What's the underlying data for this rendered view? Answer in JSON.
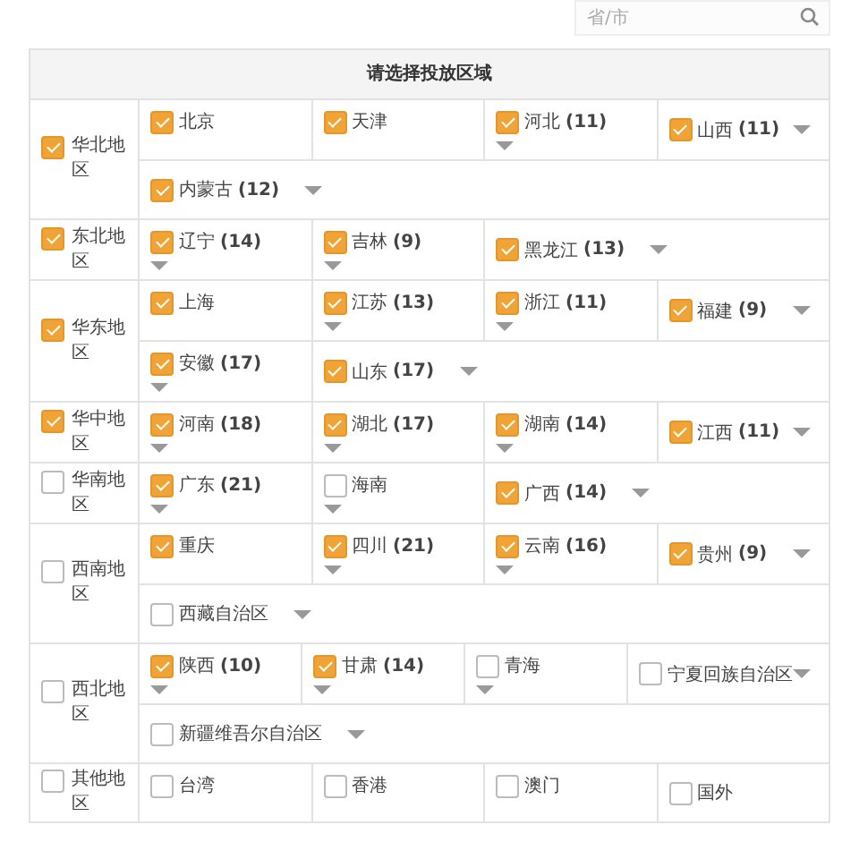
{
  "search": {
    "placeholder": "省/市"
  },
  "table": {
    "title": "请选择投放区域"
  },
  "regions": [
    {
      "name": "华北地区",
      "checked": true,
      "rows": [
        {
          "items": [
            {
              "name": "北京",
              "checked": true,
              "has_dropdown": false
            },
            {
              "name": "天津",
              "checked": true,
              "has_dropdown": false
            },
            {
              "name": "河北",
              "count": "(11)",
              "checked": true,
              "has_dropdown": true
            },
            {
              "name": "山西",
              "count": "(11)",
              "checked": true,
              "has_dropdown": true
            }
          ]
        },
        {
          "items": [
            {
              "name": "内蒙古",
              "count": "(12)",
              "checked": true,
              "has_dropdown": true
            }
          ]
        }
      ]
    },
    {
      "name": "东北地区",
      "checked": true,
      "rows": [
        {
          "items": [
            {
              "name": "辽宁",
              "count": "(14)",
              "checked": true,
              "has_dropdown": true
            },
            {
              "name": "吉林",
              "count": "(9)",
              "checked": true,
              "has_dropdown": true
            },
            {
              "name": "黑龙江",
              "count": "(13)",
              "checked": true,
              "has_dropdown": true
            }
          ]
        }
      ]
    },
    {
      "name": "华东地区",
      "checked": true,
      "rows": [
        {
          "items": [
            {
              "name": "上海",
              "checked": true,
              "has_dropdown": false
            },
            {
              "name": "江苏",
              "count": "(13)",
              "checked": true,
              "has_dropdown": true
            },
            {
              "name": "浙江",
              "count": "(11)",
              "checked": true,
              "has_dropdown": true
            },
            {
              "name": "福建",
              "count": "(9)",
              "checked": true,
              "has_dropdown": true
            }
          ]
        },
        {
          "items": [
            {
              "name": "安徽",
              "count": "(17)",
              "checked": true,
              "has_dropdown": true
            },
            {
              "name": "山东",
              "count": "(17)",
              "checked": true,
              "has_dropdown": true
            }
          ]
        }
      ]
    },
    {
      "name": "华中地区",
      "checked": true,
      "rows": [
        {
          "items": [
            {
              "name": "河南",
              "count": "(18)",
              "checked": true,
              "has_dropdown": true
            },
            {
              "name": "湖北",
              "count": "(17)",
              "checked": true,
              "has_dropdown": true
            },
            {
              "name": "湖南",
              "count": "(14)",
              "checked": true,
              "has_dropdown": true
            },
            {
              "name": "江西",
              "count": "(11)",
              "checked": true,
              "has_dropdown": true
            }
          ]
        }
      ]
    },
    {
      "name": "华南地区",
      "checked": false,
      "rows": [
        {
          "items": [
            {
              "name": "广东",
              "count": "(21)",
              "checked": true,
              "has_dropdown": true
            },
            {
              "name": "海南",
              "checked": false,
              "has_dropdown": true
            },
            {
              "name": "广西",
              "count": "(14)",
              "checked": true,
              "has_dropdown": true
            }
          ]
        }
      ]
    },
    {
      "name": "西南地区",
      "checked": false,
      "rows": [
        {
          "items": [
            {
              "name": "重庆",
              "checked": true,
              "has_dropdown": false
            },
            {
              "name": "四川",
              "count": "(21)",
              "checked": true,
              "has_dropdown": true
            },
            {
              "name": "云南",
              "count": "(16)",
              "checked": true,
              "has_dropdown": true
            },
            {
              "name": "贵州",
              "count": "(9)",
              "checked": true,
              "has_dropdown": true
            }
          ]
        },
        {
          "items": [
            {
              "name": "西藏自治区",
              "checked": false,
              "has_dropdown": true
            }
          ]
        }
      ]
    },
    {
      "name": "西北地区",
      "checked": false,
      "rows": [
        {
          "items": [
            {
              "name": "陕西",
              "count": "(10)",
              "checked": true,
              "has_dropdown": true
            },
            {
              "name": "甘肃",
              "count": "(14)",
              "checked": true,
              "has_dropdown": true
            },
            {
              "name": "青海",
              "checked": false,
              "has_dropdown": true
            },
            {
              "name": "宁夏回族自治区",
              "checked": false,
              "has_dropdown": true
            }
          ]
        },
        {
          "items": [
            {
              "name": "新疆维吾尔自治区",
              "checked": false,
              "has_dropdown": true
            }
          ]
        }
      ]
    },
    {
      "name": "其他地区",
      "checked": false,
      "rows": [
        {
          "items": [
            {
              "name": "台湾",
              "checked": false,
              "has_dropdown": false
            },
            {
              "name": "香港",
              "checked": false,
              "has_dropdown": false
            },
            {
              "name": "澳门",
              "checked": false,
              "has_dropdown": false
            },
            {
              "name": "国外",
              "checked": false,
              "has_dropdown": false
            }
          ]
        }
      ]
    }
  ]
}
